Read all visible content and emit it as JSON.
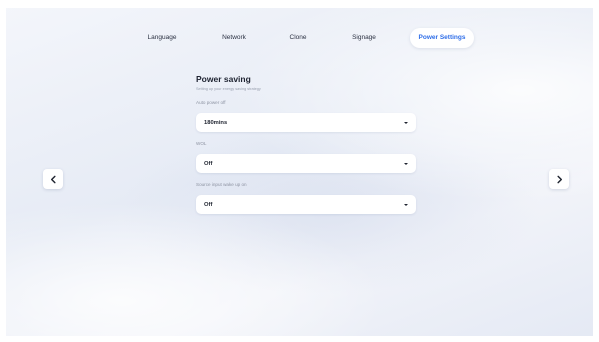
{
  "tabs": [
    {
      "label": "Language",
      "active": false
    },
    {
      "label": "Network",
      "active": false
    },
    {
      "label": "Clone",
      "active": false
    },
    {
      "label": "Signage",
      "active": false
    },
    {
      "label": "Power Settings",
      "active": true
    }
  ],
  "section": {
    "title": "Power saving",
    "subtitle": "Setting up your energy saving strategy"
  },
  "fields": [
    {
      "label": "Auto power off",
      "value": "180mins"
    },
    {
      "label": "WOL",
      "value": "Off"
    },
    {
      "label": "Source input wake up on",
      "value": "Off"
    }
  ],
  "nav": {
    "prev_icon": "chevron-left-icon",
    "next_icon": "chevron-right-icon"
  },
  "colors": {
    "accent": "#2f6ee8",
    "text": "#1f2430"
  }
}
